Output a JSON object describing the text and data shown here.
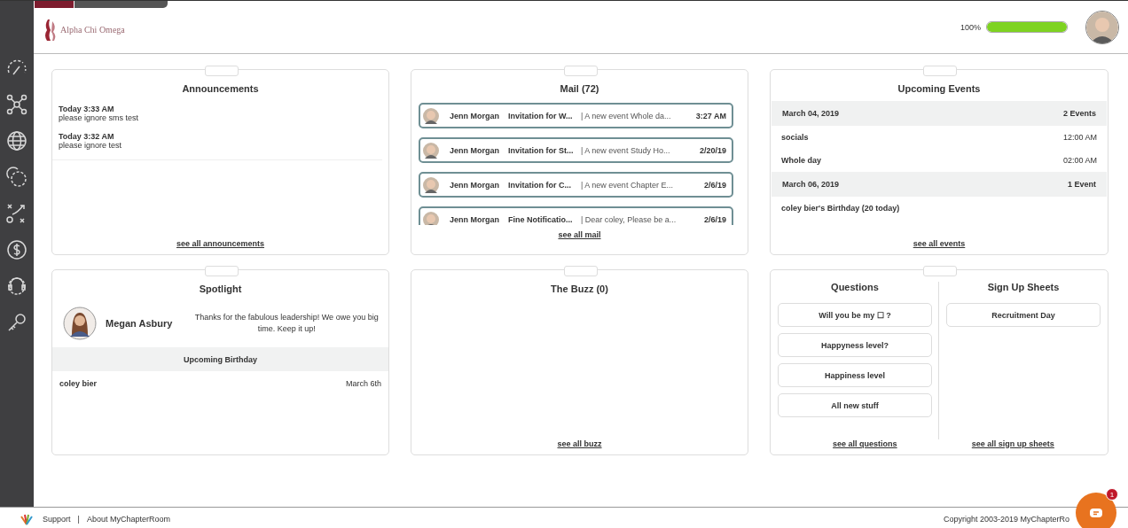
{
  "header": {
    "logo_text": "Alpha Chi Omega",
    "progress": {
      "reading": "100%",
      "level": 1.0
    }
  },
  "announcements": {
    "title": "Announcements",
    "items": [
      {
        "time": "Today 3:33 AM",
        "text": "please ignore sms test"
      },
      {
        "time": "Today 3:32 AM",
        "text": "please ignore test"
      }
    ],
    "link": "see all announcements"
  },
  "mail": {
    "title": "Mail (72)",
    "rows": [
      {
        "sender": "Jenn Morgan",
        "subject": "Invitation for W...",
        "preview": "| A new event Whole da...",
        "date": "3:27 AM"
      },
      {
        "sender": "Jenn Morgan",
        "subject": "Invitation for St...",
        "preview": "| A new event Study Ho...",
        "date": "2/20/19"
      },
      {
        "sender": "Jenn Morgan",
        "subject": "Invitation for C...",
        "preview": "| A new event Chapter E...",
        "date": "2/6/19"
      },
      {
        "sender": "Jenn Morgan",
        "subject": "Fine Notificatio...",
        "preview": "| Dear coley, Please be a...",
        "date": "2/6/19"
      }
    ],
    "link": "see all mail"
  },
  "events": {
    "title": "Upcoming Events",
    "rows": [
      {
        "kind": "day",
        "label": "March 04, 2019",
        "value": "2 Events"
      },
      {
        "kind": "event",
        "label": "socials",
        "value": "12:00 AM"
      },
      {
        "kind": "event",
        "label": "Whole day",
        "value": "02:00 AM"
      },
      {
        "kind": "day",
        "label": "March 06, 2019",
        "value": "1 Event"
      },
      {
        "kind": "event",
        "label": "coley bier's Birthday (20 today)"
      }
    ],
    "link": "see all events"
  },
  "spotlight": {
    "title": "Spotlight",
    "name": "Megan Asbury",
    "message": "Thanks for the fabulous leadership! We owe you big time. Keep it up!",
    "birthday_heading": "Upcoming Birthday",
    "birthdays": [
      {
        "name": "coley bier",
        "date": "March 6th"
      }
    ]
  },
  "buzz": {
    "title": "The Buzz (0)",
    "link": "see all buzz"
  },
  "questions": {
    "title": "Questions",
    "items": [
      "Will you be my ☐ ?",
      "Happyness level?",
      "Happiness level",
      "All new stuff"
    ],
    "link": "see all questions"
  },
  "signups": {
    "title": "Sign Up Sheets",
    "items": [
      "Recruitment Day"
    ],
    "link": "see all sign up sheets"
  },
  "footer": {
    "links": [
      "Support",
      "About MyChapterRoom"
    ],
    "separator": "|",
    "copyright": "Copyright 2003-2019 MyChapterRo"
  },
  "chat": {
    "badge": "1"
  }
}
